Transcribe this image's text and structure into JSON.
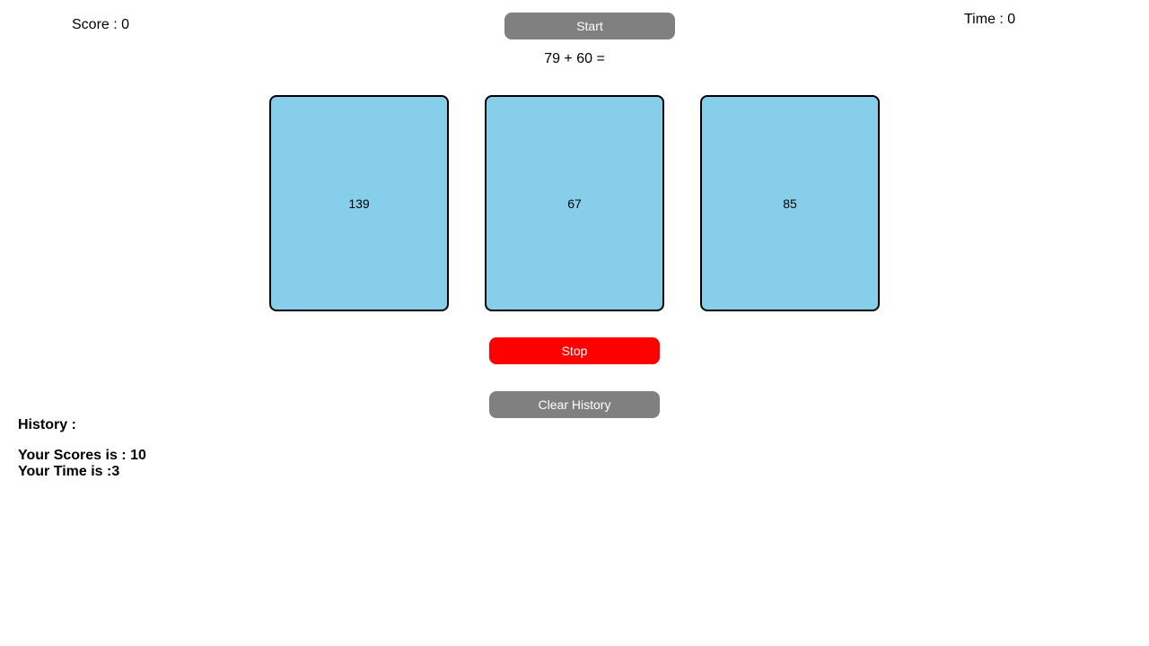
{
  "header": {
    "score_text": "Score : 0",
    "time_text": "Time : 0",
    "start_label": "Start"
  },
  "question": {
    "text": "79 + 60 ="
  },
  "cards": [
    {
      "value": "139"
    },
    {
      "value": "67"
    },
    {
      "value": "85"
    }
  ],
  "controls": {
    "stop_label": "Stop",
    "clear_history_label": "Clear History"
  },
  "history": {
    "title": "History :",
    "scores_line": "Your Scores is : 10",
    "time_line": "Your Time is :3"
  },
  "colors": {
    "card_fill": "#87ceeb",
    "stop_button": "#ff0000",
    "neutral_button": "#808080"
  }
}
